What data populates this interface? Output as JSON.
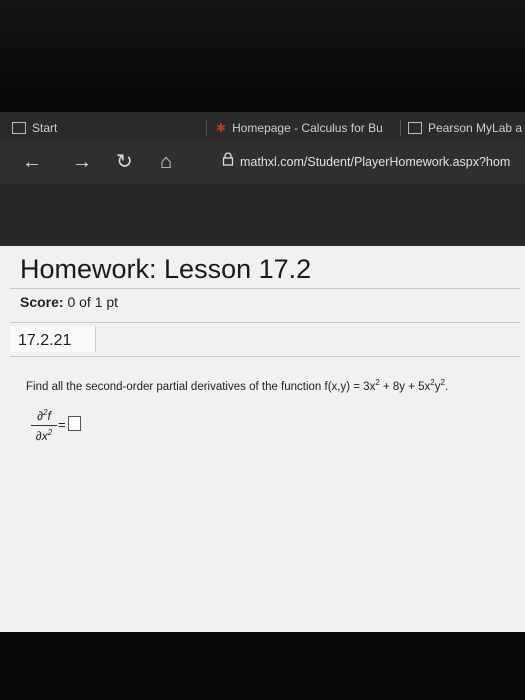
{
  "tabs": [
    {
      "label": "Start",
      "icon": "start-icon"
    },
    {
      "label": "Homepage - Calculus for Bu",
      "icon": "pearson-logo-icon"
    },
    {
      "label": "Pearson MyLab a",
      "icon": "page-icon"
    }
  ],
  "nav": {
    "back": "←",
    "forward": "→",
    "refresh": "↻",
    "home": "⌂",
    "url": "mathxl.com/Student/PlayerHomework.aspx?hom"
  },
  "page": {
    "title": "Homework: Lesson 17.2",
    "score_label": "Score:",
    "score_value": "0 of 1 pt",
    "question_number": "17.2.21",
    "question_text": "Find all the second-order partial derivatives of the function f(x,y) = 3x",
    "question_tail_1": " + 8y + 5x",
    "question_tail_2": "y",
    "question_tail_3": ".",
    "exp": "2",
    "frac_num": "∂",
    "frac_num_f": "f",
    "frac_den": "∂x",
    "equals": "=",
    "answer_value": ""
  },
  "colors": {
    "page_bg": "#f1f1f1",
    "chrome_bg": "#2f2f2f"
  }
}
